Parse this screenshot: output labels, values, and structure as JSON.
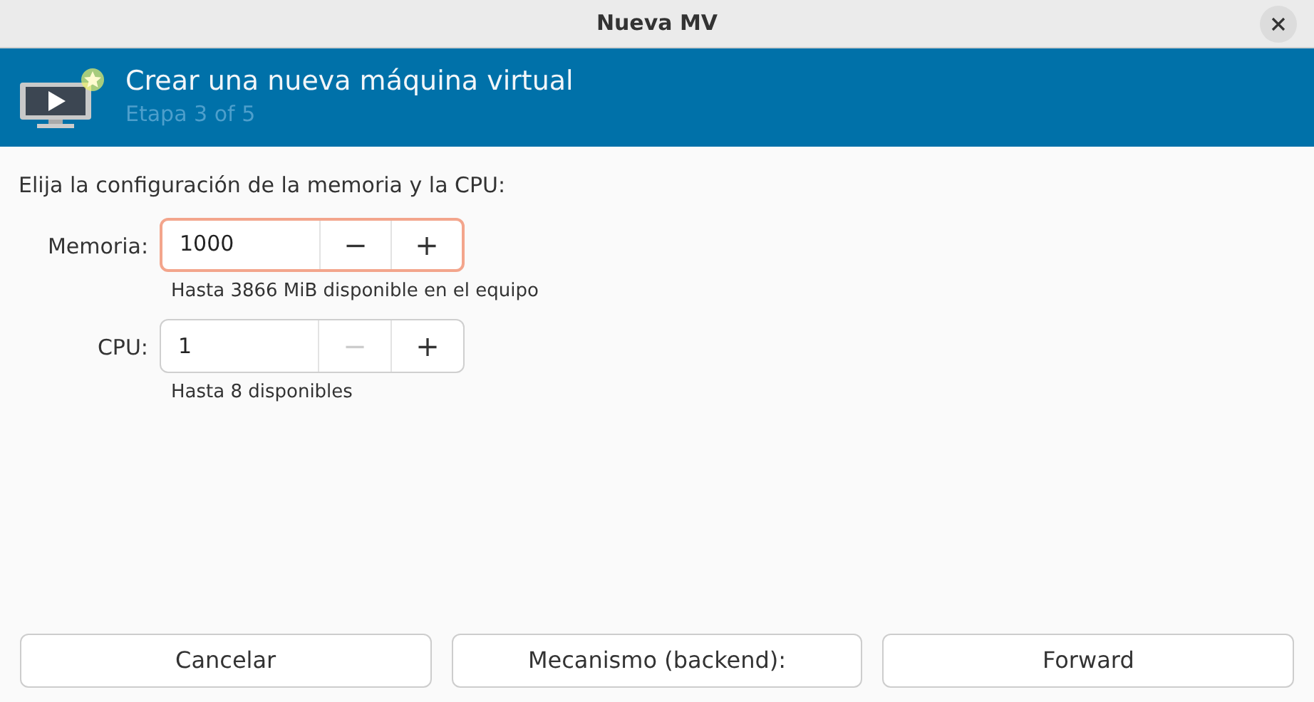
{
  "window": {
    "title": "Nueva MV"
  },
  "banner": {
    "title": "Crear una nueva máquina virtual",
    "subtitle": "Etapa 3 of 5"
  },
  "prompt": "Elija la configuración de la memoria y la CPU:",
  "fields": [
    {
      "label": "Memoria:",
      "value": "1000",
      "focused": true,
      "minus": {
        "text": "−",
        "disabled": false
      },
      "plus": {
        "text": "+",
        "disabled": false
      },
      "hint": "Hasta 3866 MiB disponible en el equipo"
    },
    {
      "label": "CPU:",
      "value": "1",
      "focused": false,
      "minus": {
        "text": "−",
        "disabled": true
      },
      "plus": {
        "text": "+",
        "disabled": false
      },
      "hint": "Hasta 8 disponibles"
    }
  ],
  "buttons": [
    "Cancelar",
    "Mecanismo (backend):",
    "Forward"
  ]
}
